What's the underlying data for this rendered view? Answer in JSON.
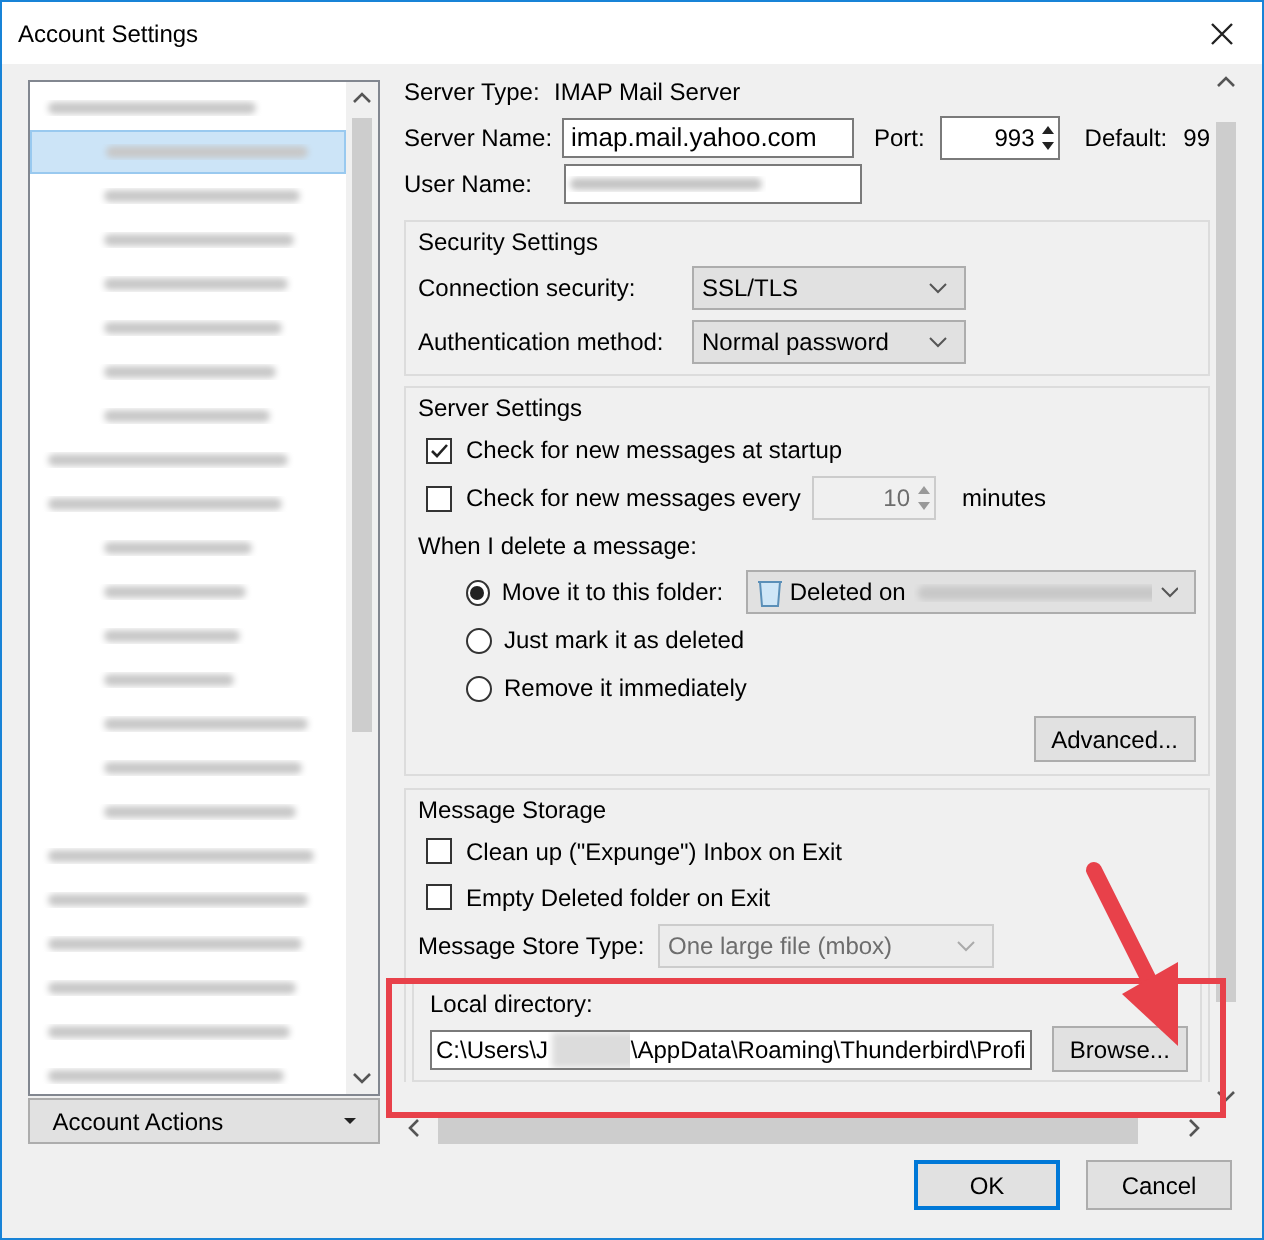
{
  "window": {
    "title": "Account Settings"
  },
  "account_tree": {
    "items": [
      {
        "selected": false,
        "children": [
          {
            "selected": true
          },
          {
            "selected": false
          },
          {
            "selected": false
          },
          {
            "selected": false
          },
          {
            "selected": false
          },
          {
            "selected": false
          },
          {
            "selected": false
          }
        ]
      },
      {
        "selected": false
      },
      {
        "selected": false,
        "children": [
          {
            "selected": false
          },
          {
            "selected": false
          },
          {
            "selected": false
          },
          {
            "selected": false
          },
          {
            "selected": false
          },
          {
            "selected": false
          },
          {
            "selected": false
          }
        ]
      },
      {
        "selected": false
      },
      {
        "selected": false
      },
      {
        "selected": false
      },
      {
        "selected": false
      },
      {
        "selected": false
      },
      {
        "selected": false
      }
    ]
  },
  "account_actions": {
    "label": "Account Actions"
  },
  "server": {
    "type_label": "Server Type:",
    "type_value": "IMAP Mail Server",
    "name_label": "Server Name:",
    "name_value": "imap.mail.yahoo.com",
    "port_label": "Port:",
    "port_value": "993",
    "default_label": "Default:",
    "default_value": "99",
    "user_label": "User Name:"
  },
  "security": {
    "title": "Security Settings",
    "fields": [
      {
        "label": "Connection security:",
        "value": "SSL/TLS"
      },
      {
        "label": "Authentication method:",
        "value": "Normal password"
      }
    ]
  },
  "server_settings": {
    "title": "Server Settings",
    "check_startup": {
      "label": "Check for new messages at startup",
      "checked": true
    },
    "check_every": {
      "label": "Check for new messages every",
      "checked": false,
      "value": "10",
      "unit": "minutes",
      "disabled": true
    },
    "delete_label": "When I delete a message:",
    "delete_options": [
      {
        "label": "Move it to this folder:",
        "selected": true
      },
      {
        "label": "Just mark it as deleted",
        "selected": false
      },
      {
        "label": "Remove it immediately",
        "selected": false
      }
    ],
    "folder": "Deleted on",
    "advanced": "Advanced..."
  },
  "storage": {
    "title": "Message Storage",
    "checks": [
      {
        "label": "Clean up (\"Expunge\") Inbox on Exit",
        "checked": false
      },
      {
        "label": "Empty Deleted folder on Exit",
        "checked": false
      }
    ],
    "store_type_label": "Message Store Type:",
    "store_type_value": "One large file (mbox)",
    "store_type_disabled": true,
    "local_dir_label": "Local directory:",
    "local_dir_start": "C:\\Users\\J",
    "local_dir_end": "\\AppData\\Roaming\\Thunderbird\\Profi",
    "browse": "Browse..."
  },
  "buttons": [
    {
      "label": "OK",
      "default": true
    },
    {
      "label": "Cancel",
      "default": false
    }
  ]
}
